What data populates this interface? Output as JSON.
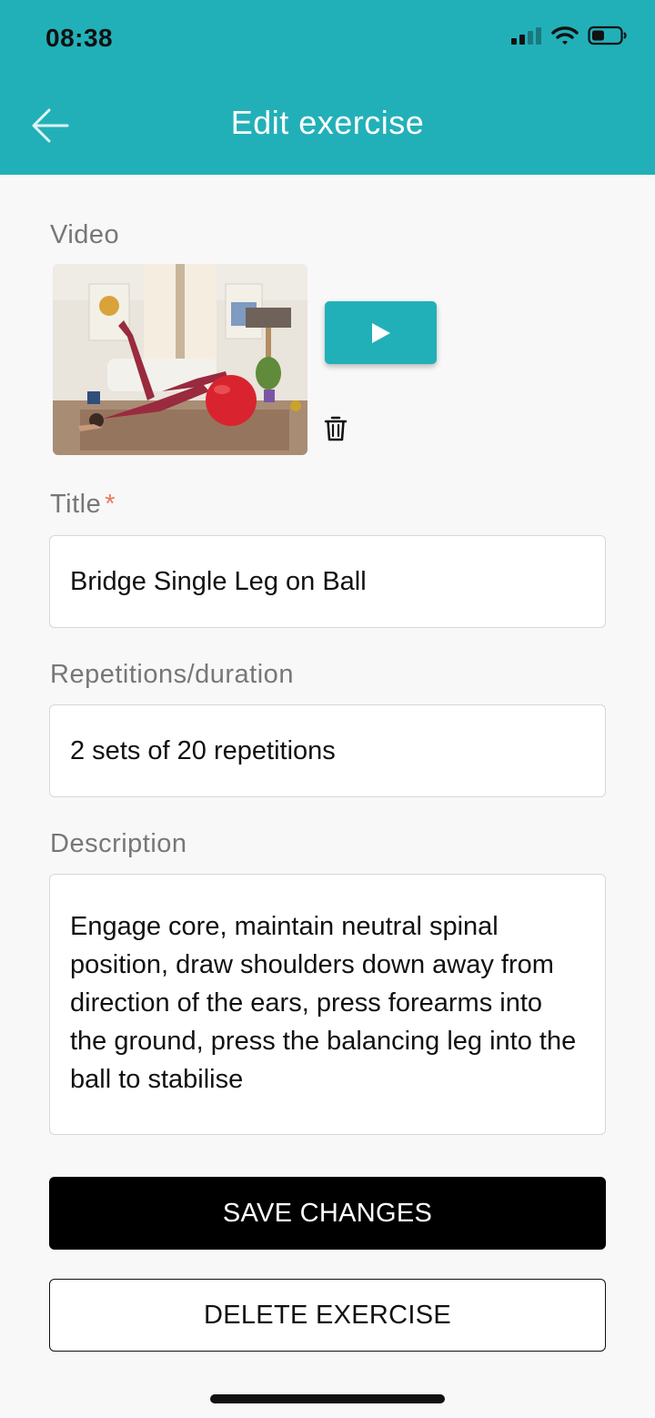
{
  "status_bar": {
    "time": "08:38"
  },
  "header": {
    "title": "Edit exercise"
  },
  "video": {
    "label": "Video"
  },
  "title_field": {
    "label": "Title",
    "required_mark": "*",
    "value": "Bridge Single Leg on Ball"
  },
  "reps_field": {
    "label": "Repetitions/duration",
    "value": "2 sets of 20 repetitions"
  },
  "description_field": {
    "label": "Description",
    "value": "Engage core, maintain neutral spinal position, draw shoulders down away from direction of the ears, press forearms into the ground, press the balancing leg into the ball to stabilise"
  },
  "actions": {
    "save_label": "SAVE CHANGES",
    "delete_label": "DELETE EXERCISE"
  },
  "colors": {
    "accent": "#22b0b8",
    "primary_button": "#000000",
    "required": "#e8785a"
  }
}
